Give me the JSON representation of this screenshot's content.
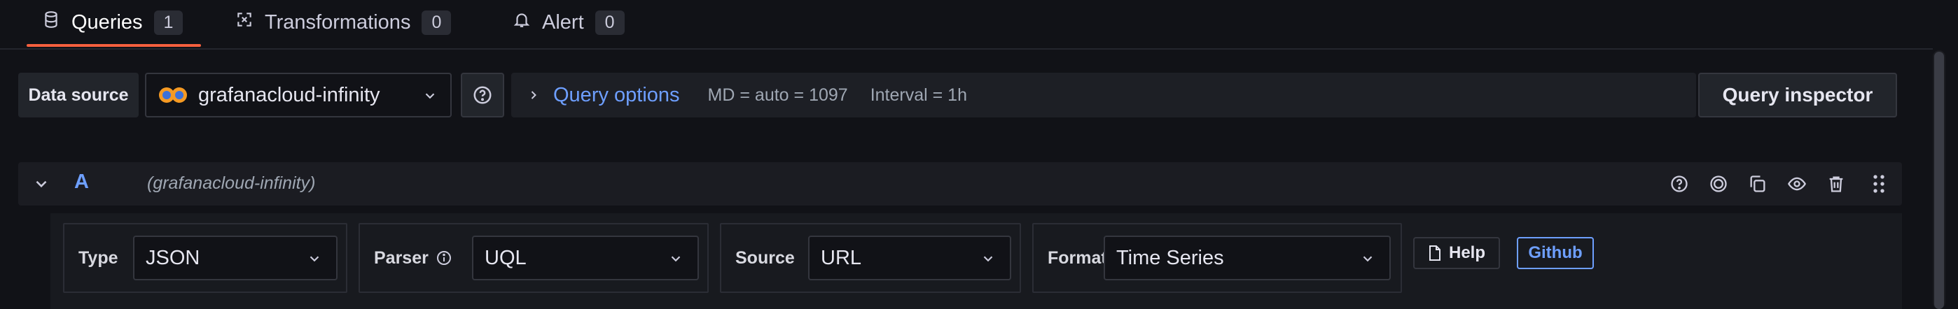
{
  "tabs": [
    {
      "label": "Queries",
      "count": "1",
      "icon": "database-icon",
      "active": true
    },
    {
      "label": "Transformations",
      "count": "0",
      "icon": "transform-icon",
      "active": false
    },
    {
      "label": "Alert",
      "count": "0",
      "icon": "bell-icon",
      "active": false
    }
  ],
  "toolbar": {
    "data_source_label": "Data source",
    "data_source_value": "grafanacloud-infinity",
    "query_options_title": "Query options",
    "md_text": "MD = auto = 1097",
    "interval_text": "Interval = 1h",
    "query_inspector_label": "Query inspector"
  },
  "query_row": {
    "letter": "A",
    "datasource": "(grafanacloud-infinity)"
  },
  "fields": {
    "type_label": "Type",
    "type_value": "JSON",
    "parser_label": "Parser",
    "parser_value": "UQL",
    "source_label": "Source",
    "source_value": "URL",
    "format_label": "Format",
    "format_value": "Time Series",
    "help_label": "Help",
    "github_label": "Github"
  },
  "colors": {
    "accent": "#6e9fff",
    "active_tab": "#f55f3e",
    "background": "#111217"
  }
}
